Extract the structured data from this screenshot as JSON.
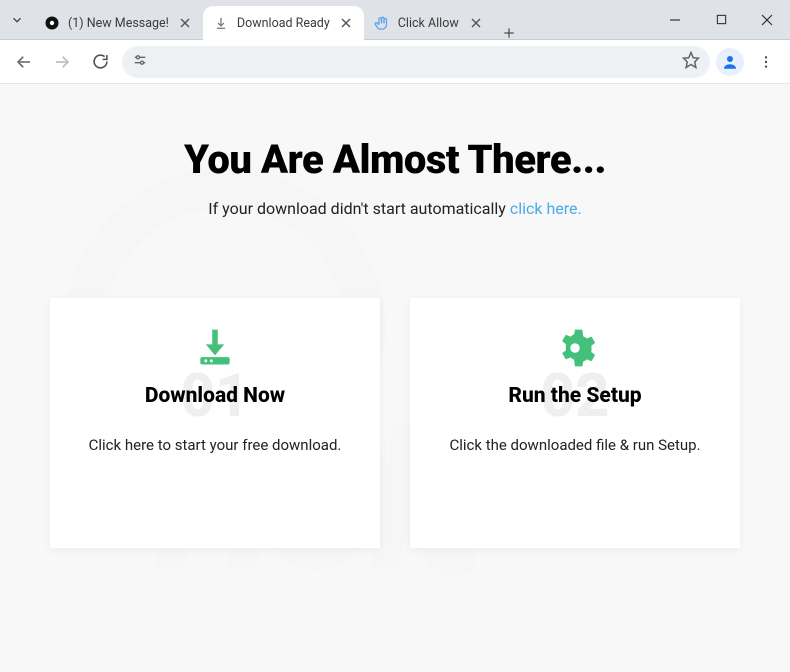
{
  "browser": {
    "tabs": [
      {
        "title": "(1) New Message!",
        "active": false,
        "favicon": "dot"
      },
      {
        "title": "Download Ready",
        "active": true,
        "favicon": "download"
      },
      {
        "title": "Click Allow",
        "active": false,
        "favicon": "hand"
      }
    ],
    "address": {
      "value": "",
      "placeholder": ""
    }
  },
  "hero": {
    "headline": "You Are Almost There...",
    "subtext": "If your download didn't start automatically ",
    "link": "click here."
  },
  "cards": [
    {
      "num": "01",
      "title": "Download Now",
      "desc": "Click here to start your free download.",
      "icon": "download"
    },
    {
      "num": "02",
      "title": "Run the Setup",
      "desc": "Click the downloaded file & run Setup.",
      "icon": "gear"
    }
  ],
  "colors": {
    "accent": "#43c17b",
    "link": "#4aa9e8"
  }
}
